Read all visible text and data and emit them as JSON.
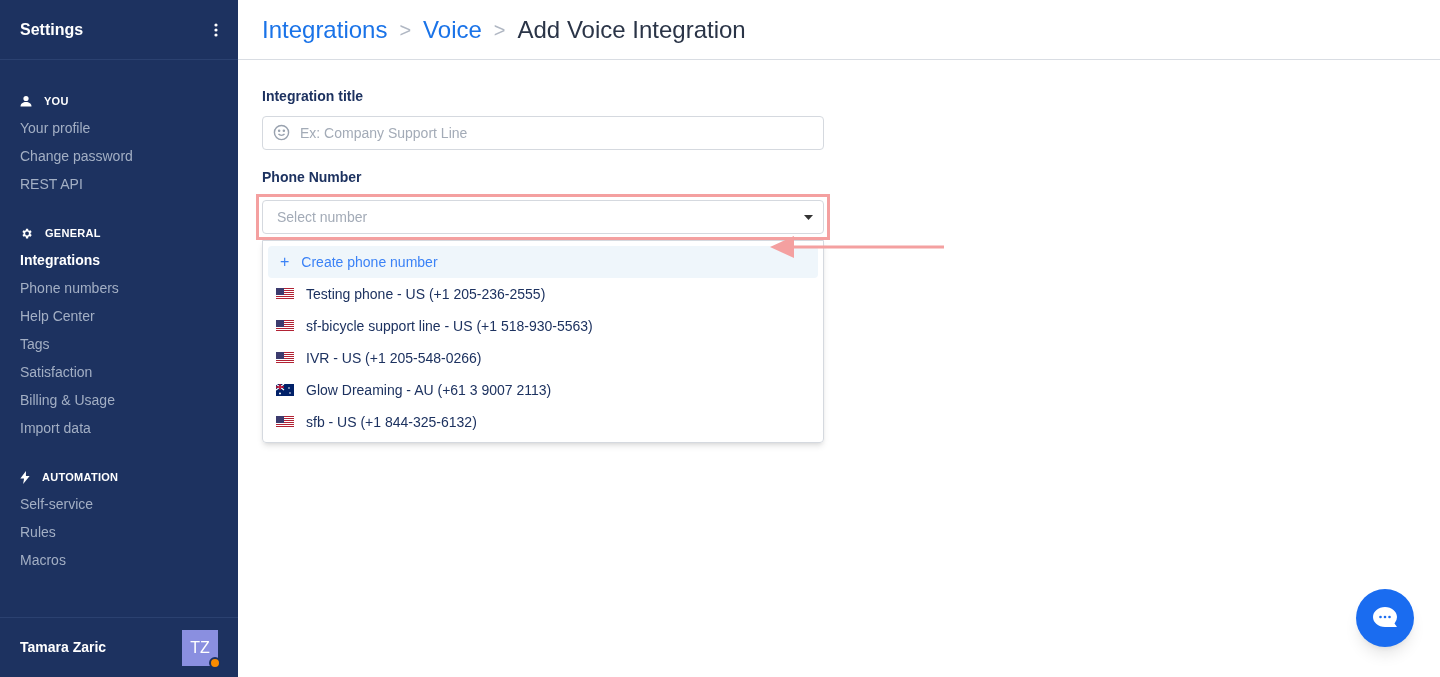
{
  "sidebar": {
    "title": "Settings",
    "sections": [
      {
        "kind": "user",
        "heading": "YOU",
        "items": [
          {
            "label": "Your profile",
            "selected": false
          },
          {
            "label": "Change password",
            "selected": false
          },
          {
            "label": "REST API",
            "selected": false
          }
        ]
      },
      {
        "kind": "gear",
        "heading": "GENERAL",
        "items": [
          {
            "label": "Integrations",
            "selected": true
          },
          {
            "label": "Phone numbers",
            "selected": false
          },
          {
            "label": "Help Center",
            "selected": false
          },
          {
            "label": "Tags",
            "selected": false
          },
          {
            "label": "Satisfaction",
            "selected": false
          },
          {
            "label": "Billing & Usage",
            "selected": false
          },
          {
            "label": "Import data",
            "selected": false
          }
        ]
      },
      {
        "kind": "bolt",
        "heading": "AUTOMATION",
        "items": [
          {
            "label": "Self-service",
            "selected": false
          },
          {
            "label": "Rules",
            "selected": false
          },
          {
            "label": "Macros",
            "selected": false
          }
        ]
      }
    ],
    "user": {
      "name": "Tamara Zaric",
      "initials": "TZ",
      "online": true
    }
  },
  "breadcrumb": {
    "links": [
      "Integrations",
      "Voice"
    ],
    "separator": ">",
    "current": "Add Voice Integration"
  },
  "form": {
    "title_label": "Integration title",
    "title_placeholder": "Ex: Company Support Line",
    "phone_label": "Phone Number",
    "phone_placeholder": "Select number",
    "options": [
      {
        "kind": "create",
        "icon": "+",
        "label": "Create phone number",
        "highlighted": true
      },
      {
        "kind": "us",
        "label": "Testing phone - US (+1 205-236-2555)",
        "highlighted": false
      },
      {
        "kind": "us",
        "label": "sf-bicycle support line - US (+1 518-930-5563)",
        "highlighted": false
      },
      {
        "kind": "us",
        "label": "IVR - US (+1 205-548-0266)",
        "highlighted": false
      },
      {
        "kind": "au",
        "label": "Glow Dreaming - AU (+61 3 9007 2113)",
        "highlighted": false
      },
      {
        "kind": "us",
        "label": "sfb - US (+1 844-325-6132)",
        "highlighted": false
      }
    ]
  }
}
